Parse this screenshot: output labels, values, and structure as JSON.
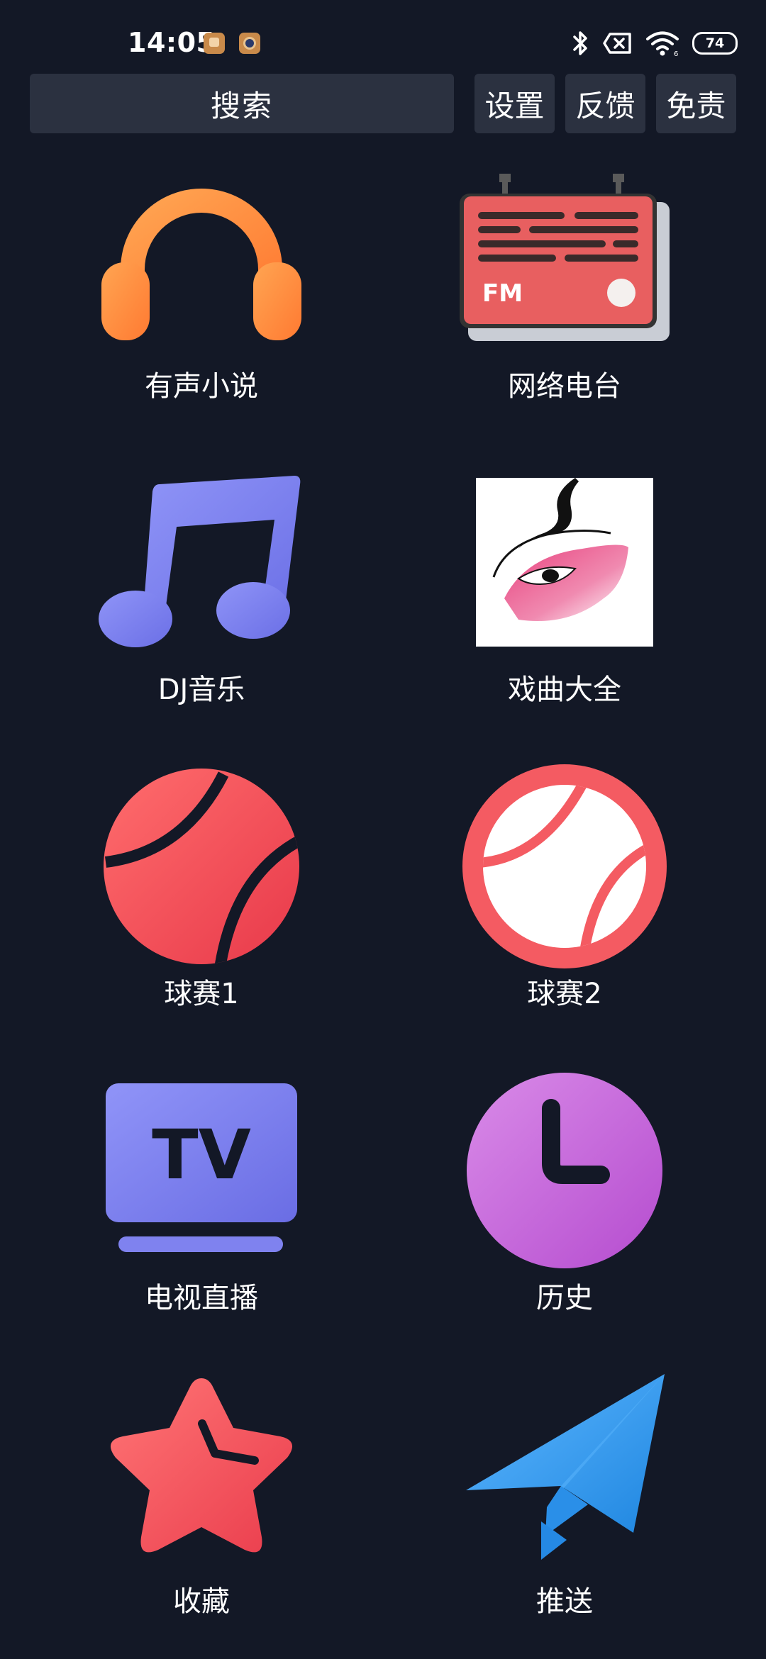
{
  "status_bar": {
    "time": "14:05",
    "battery": "74",
    "icons": [
      "notification-app-icon",
      "notification-app-icon",
      "bluetooth-icon",
      "no-sim-icon",
      "wifi-icon",
      "battery-icon"
    ]
  },
  "top_bar": {
    "search_label": "搜索",
    "settings_label": "设置",
    "feedback_label": "反馈",
    "disclaimer_label": "免责"
  },
  "grid": {
    "items": [
      {
        "label": "有声小说",
        "icon": "headphones-icon"
      },
      {
        "label": "网络电台",
        "icon": "fm-radio-icon"
      },
      {
        "label": "DJ音乐",
        "icon": "music-note-icon"
      },
      {
        "label": "戏曲大全",
        "icon": "opera-face-icon"
      },
      {
        "label": "球赛1",
        "icon": "ball-icon"
      },
      {
        "label": "球赛2",
        "icon": "ball-outline-icon"
      },
      {
        "label": "电视直播",
        "icon": "tv-icon"
      },
      {
        "label": "历史",
        "icon": "clock-icon"
      },
      {
        "label": "收藏",
        "icon": "star-icon"
      },
      {
        "label": "推送",
        "icon": "paper-plane-icon"
      }
    ]
  },
  "colors": {
    "background": "#131826",
    "button_bg": "#2b3140",
    "orange": "#ff8a3d",
    "red": "#f2545b",
    "indigo": "#7b7df0",
    "purple": "#c45fd8",
    "blue": "#2b8fe6"
  }
}
